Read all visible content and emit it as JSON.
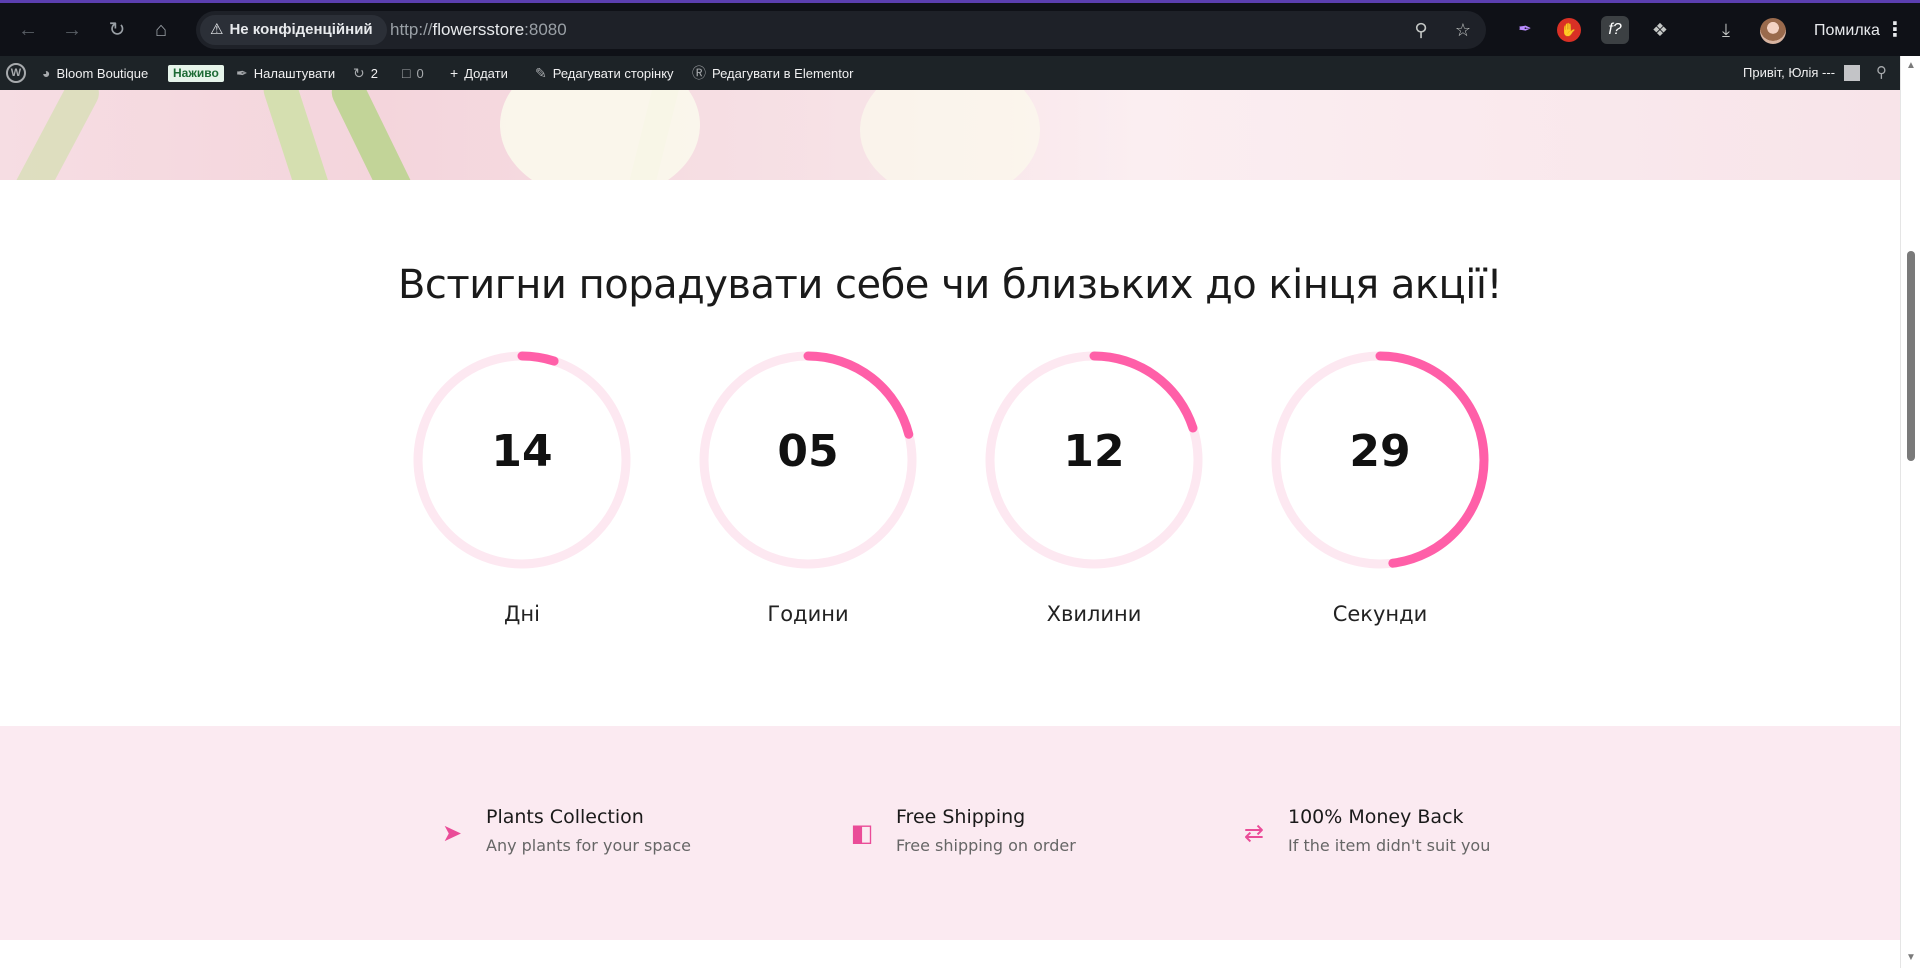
{
  "browser": {
    "security_label": "Не конфіденційний",
    "url_scheme": "http://",
    "url_host": "flowersstore",
    "url_port": ":8080",
    "profile_label": "Помилка",
    "icons": [
      "back-icon",
      "forward-icon",
      "reload-icon",
      "home-icon",
      "zoom-icon",
      "star-icon",
      "downloads-icon",
      "extensions-icon"
    ]
  },
  "wp_admin_bar": {
    "site_name": "Bloom Boutique",
    "live_badge": "Наживо",
    "customize": "Налаштувати",
    "updates_count": "2",
    "comments_count": "0",
    "add_new": "Додати",
    "edit_page": "Редагувати сторінку",
    "edit_elementor": "Редагувати в Elementor",
    "greeting": "Привіт, Юлія ---"
  },
  "countdown": {
    "title": "Встигни порадувати себе чи близьких до кінця акції!",
    "accent_color": "#ff5fa8",
    "track_color": "#fde8f1",
    "items": [
      {
        "value": "14",
        "label": "Дні",
        "progress": 0.05
      },
      {
        "value": "05",
        "label": "Години",
        "progress": 0.21
      },
      {
        "value": "12",
        "label": "Хвилини",
        "progress": 0.2
      },
      {
        "value": "29",
        "label": "Секунди",
        "progress": 0.48
      }
    ]
  },
  "features": [
    {
      "icon": "leaf-arrow-icon",
      "title": "Plants Collection",
      "desc": "Any plants for your space"
    },
    {
      "icon": "box-icon",
      "title": "Free Shipping",
      "desc": "Free shipping on order"
    },
    {
      "icon": "refresh-icon",
      "title": "100% Money Back",
      "desc": "If the item didn't suit you"
    }
  ]
}
